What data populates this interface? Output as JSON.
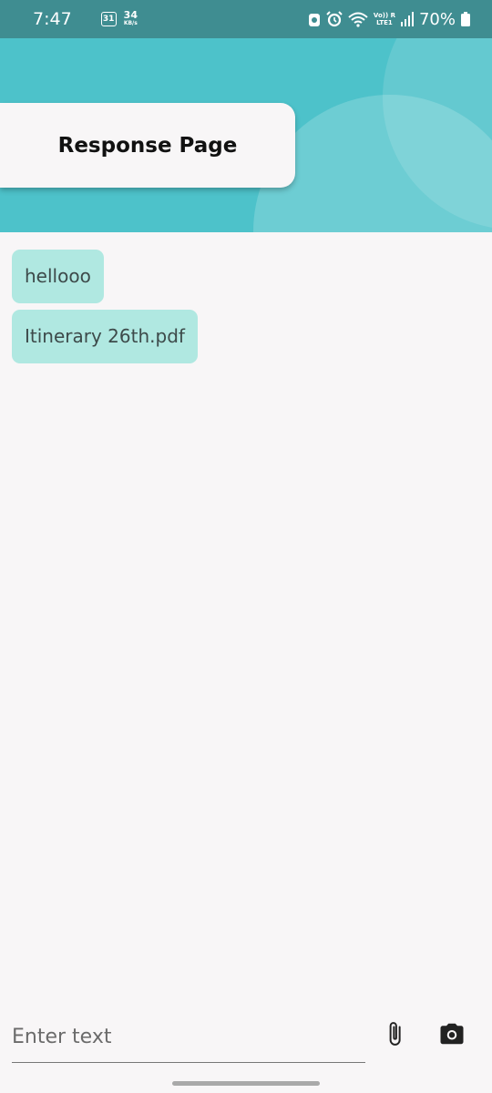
{
  "status_bar": {
    "time": "7:47",
    "calendar_day": "31",
    "speed_value": "34",
    "speed_unit": "KB/s",
    "net_top": "Vo)) R",
    "net_bottom": "LTE1",
    "battery_percent": "70%"
  },
  "header": {
    "title": "Response Page"
  },
  "messages": [
    {
      "text": "hellooo"
    },
    {
      "text": "Itinerary 26th.pdf"
    }
  ],
  "composer": {
    "placeholder": "Enter text",
    "value": ""
  },
  "colors": {
    "status_bar": "#3f8d91",
    "header": "#4dc2ca",
    "bubble": "#b0e8e1",
    "background": "#f8f6f7"
  },
  "icons": {
    "attach": "paperclip-icon",
    "camera": "camera-icon"
  }
}
